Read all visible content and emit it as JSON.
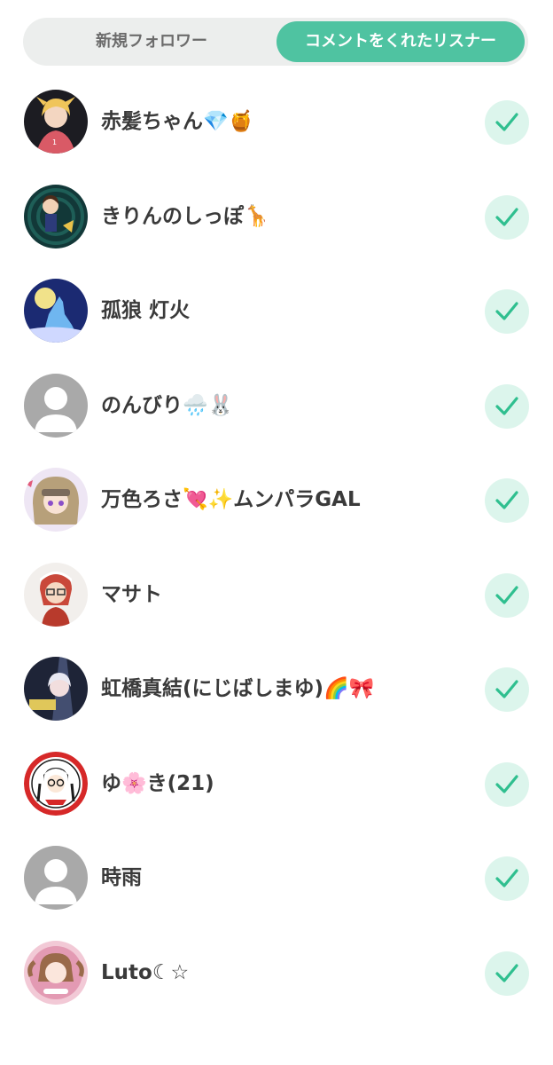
{
  "tabs": {
    "new_followers": "新規フォロワー",
    "commenters": "コメントをくれたリスナー",
    "active_color": "#4fc3a1"
  },
  "listeners": [
    {
      "name": "赤髪ちゃん💎🍯",
      "avatar": "girl-photo-avatar",
      "followed": true
    },
    {
      "name": "きりんのしっぽ🦒",
      "avatar": "character-avatar",
      "followed": true
    },
    {
      "name": "孤狼 灯火",
      "avatar": "wolf-moon-avatar",
      "followed": true
    },
    {
      "name": "のんびり🌧️🐰",
      "avatar": "default-avatar",
      "followed": true
    },
    {
      "name": "万色ろさ💘✨ムンパラGAL",
      "avatar": "anime-girl-avatar",
      "followed": true
    },
    {
      "name": "マサト",
      "avatar": "red-hair-character-avatar",
      "followed": true
    },
    {
      "name": "虹橋真結(にじばしまゆ)🌈🎀",
      "avatar": "idol-avatar",
      "followed": true
    },
    {
      "name": "ゆ🌸き(21)",
      "avatar": "badge-character-avatar",
      "followed": true
    },
    {
      "name": "時雨",
      "avatar": "default-avatar",
      "followed": true
    },
    {
      "name": "Luto☾☆",
      "avatar": "pink-character-avatar",
      "followed": true
    }
  ],
  "check_color": "#2fbf8f"
}
